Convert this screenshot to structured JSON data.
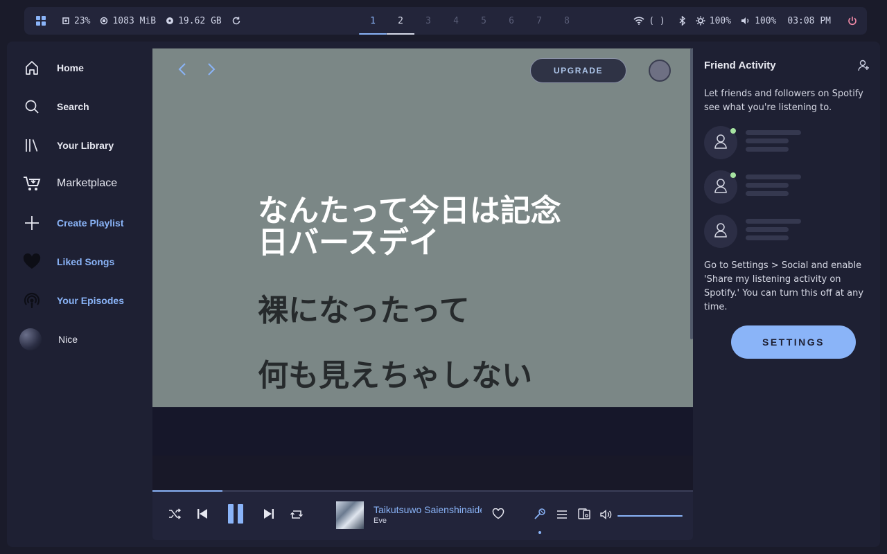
{
  "topbar": {
    "cpu": "23%",
    "memory": "1083 MiB",
    "disk": "19.62 GB",
    "workspaces": [
      "1",
      "2",
      "3",
      "4",
      "5",
      "6",
      "7",
      "8"
    ],
    "network": "( )",
    "brightness": "100%",
    "volume": "100%",
    "clock": "03:08 PM",
    "icons": [
      "apps-grid-icon",
      "cpu-chip-icon",
      "memory-icon",
      "disk-icon",
      "refresh-icon",
      "wifi-icon",
      "bluetooth-icon",
      "brightness-icon",
      "speaker-icon",
      "power-icon"
    ]
  },
  "sidebar": {
    "items": [
      {
        "label": "Home",
        "icon": "home-icon"
      },
      {
        "label": "Search",
        "icon": "search-icon"
      },
      {
        "label": "Your Library",
        "icon": "library-icon"
      },
      {
        "label": "Marketplace",
        "icon": "cart-icon"
      },
      {
        "label": "Create Playlist",
        "icon": "plus-icon"
      },
      {
        "label": "Liked Songs",
        "icon": "heart-icon"
      },
      {
        "label": "Your Episodes",
        "icon": "podcast-icon"
      },
      {
        "label": "Nice",
        "icon": "playlist-cover"
      }
    ]
  },
  "header": {
    "upgrade_label": "UPGRADE"
  },
  "lyrics": {
    "lines": [
      {
        "text": "なんたって今日は記念日バースデイ",
        "state": "active"
      },
      {
        "text": "裸になったって",
        "state": "inactive"
      },
      {
        "text": "何も見えちゃしない",
        "state": "inactive"
      }
    ],
    "active_line_1": "なんたって今日は記念",
    "active_line_2": "日バースデイ",
    "line_2": "裸になったって",
    "line_3": "何も見えちゃしない"
  },
  "player": {
    "track_title": "Taikutsuwo Saienshinaide",
    "artist": "Eve",
    "progress_fraction": 0.13,
    "volume_fraction": 1.0,
    "state": "playing"
  },
  "friends": {
    "title": "Friend Activity",
    "intro": "Let friends and followers on Spotify see what you're listening to.",
    "instructions": "Go to Settings > Social and enable 'Share my listening activity on Spotify.' You can turn this off at any time.",
    "settings_label": "SETTINGS"
  },
  "colors": {
    "accent": "#8ab4f8",
    "background": "#1a1b2a",
    "panel": "#1e2033",
    "lyrics_bg": "#7b8786",
    "online": "#a6e3a1",
    "power": "#f38ba8"
  }
}
